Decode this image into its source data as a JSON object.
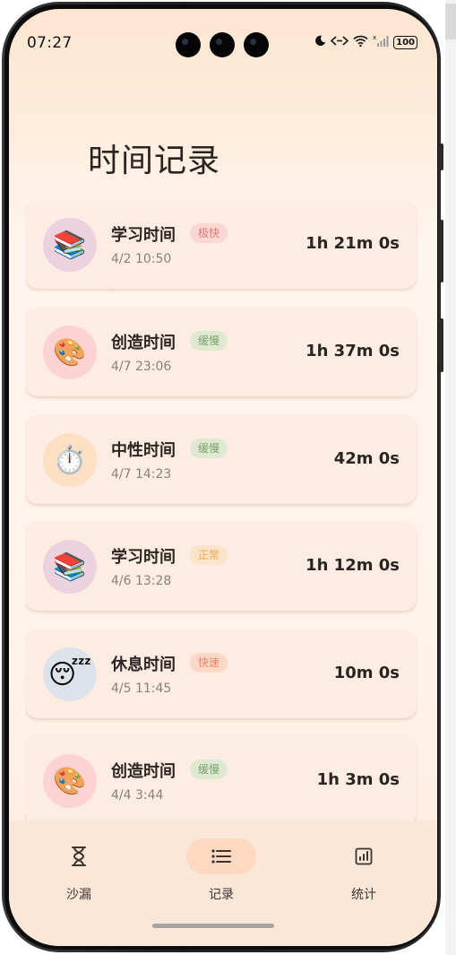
{
  "status_bar": {
    "time": "07:27",
    "icons": [
      "moon-icon",
      "data-transfer-icon",
      "wifi-icon",
      "signal-icon"
    ],
    "battery": "100"
  },
  "page": {
    "title": "时间记录"
  },
  "records": [
    {
      "category": "学习时间",
      "speed": "极快",
      "date": "4/2 10:50",
      "duration": "1h 21m 0s",
      "emoji": "📚",
      "icon": "books-icon",
      "avatar_color": "#ecd2df",
      "badge_bg": "#fbd8d3",
      "badge_fg": "#df7a70"
    },
    {
      "category": "创造时间",
      "speed": "缓慢",
      "date": "4/7 23:06",
      "duration": "1h 37m 0s",
      "emoji": "🎨",
      "icon": "palette-icon",
      "avatar_color": "#fbd3d2",
      "badge_bg": "#dfe9d1",
      "badge_fg": "#7aa470"
    },
    {
      "category": "中性时间",
      "speed": "缓慢",
      "date": "4/7 14:23",
      "duration": "42m 0s",
      "emoji": "⏱️",
      "icon": "stopwatch-icon",
      "avatar_color": "#fde0c4",
      "badge_bg": "#dfe9d1",
      "badge_fg": "#7aa470"
    },
    {
      "category": "学习时间",
      "speed": "正常",
      "date": "4/6 13:28",
      "duration": "1h 12m 0s",
      "emoji": "📚",
      "icon": "books-icon",
      "avatar_color": "#ecd2df",
      "badge_bg": "#fde3c7",
      "badge_fg": "#e9a857"
    },
    {
      "category": "休息时间",
      "speed": "快速",
      "date": "4/5 11:45",
      "duration": "10m 0s",
      "emoji": "😴",
      "icon": "sleeping-face-icon",
      "avatar_color": "#dde3ea",
      "badge_bg": "#fbd8c8",
      "badge_fg": "#e98663"
    },
    {
      "category": "创造时间",
      "speed": "缓慢",
      "date": "4/4 3:44",
      "duration": "1h 3m 0s",
      "emoji": "🎨",
      "icon": "palette-icon",
      "avatar_color": "#fbd3d2",
      "badge_bg": "#dfe9d1",
      "badge_fg": "#7aa470"
    }
  ],
  "nav": {
    "items": [
      {
        "label": "沙漏",
        "icon": "hourglass-icon",
        "active": false
      },
      {
        "label": "记录",
        "icon": "list-icon",
        "active": true
      },
      {
        "label": "统计",
        "icon": "bar-chart-icon",
        "active": false
      }
    ]
  }
}
